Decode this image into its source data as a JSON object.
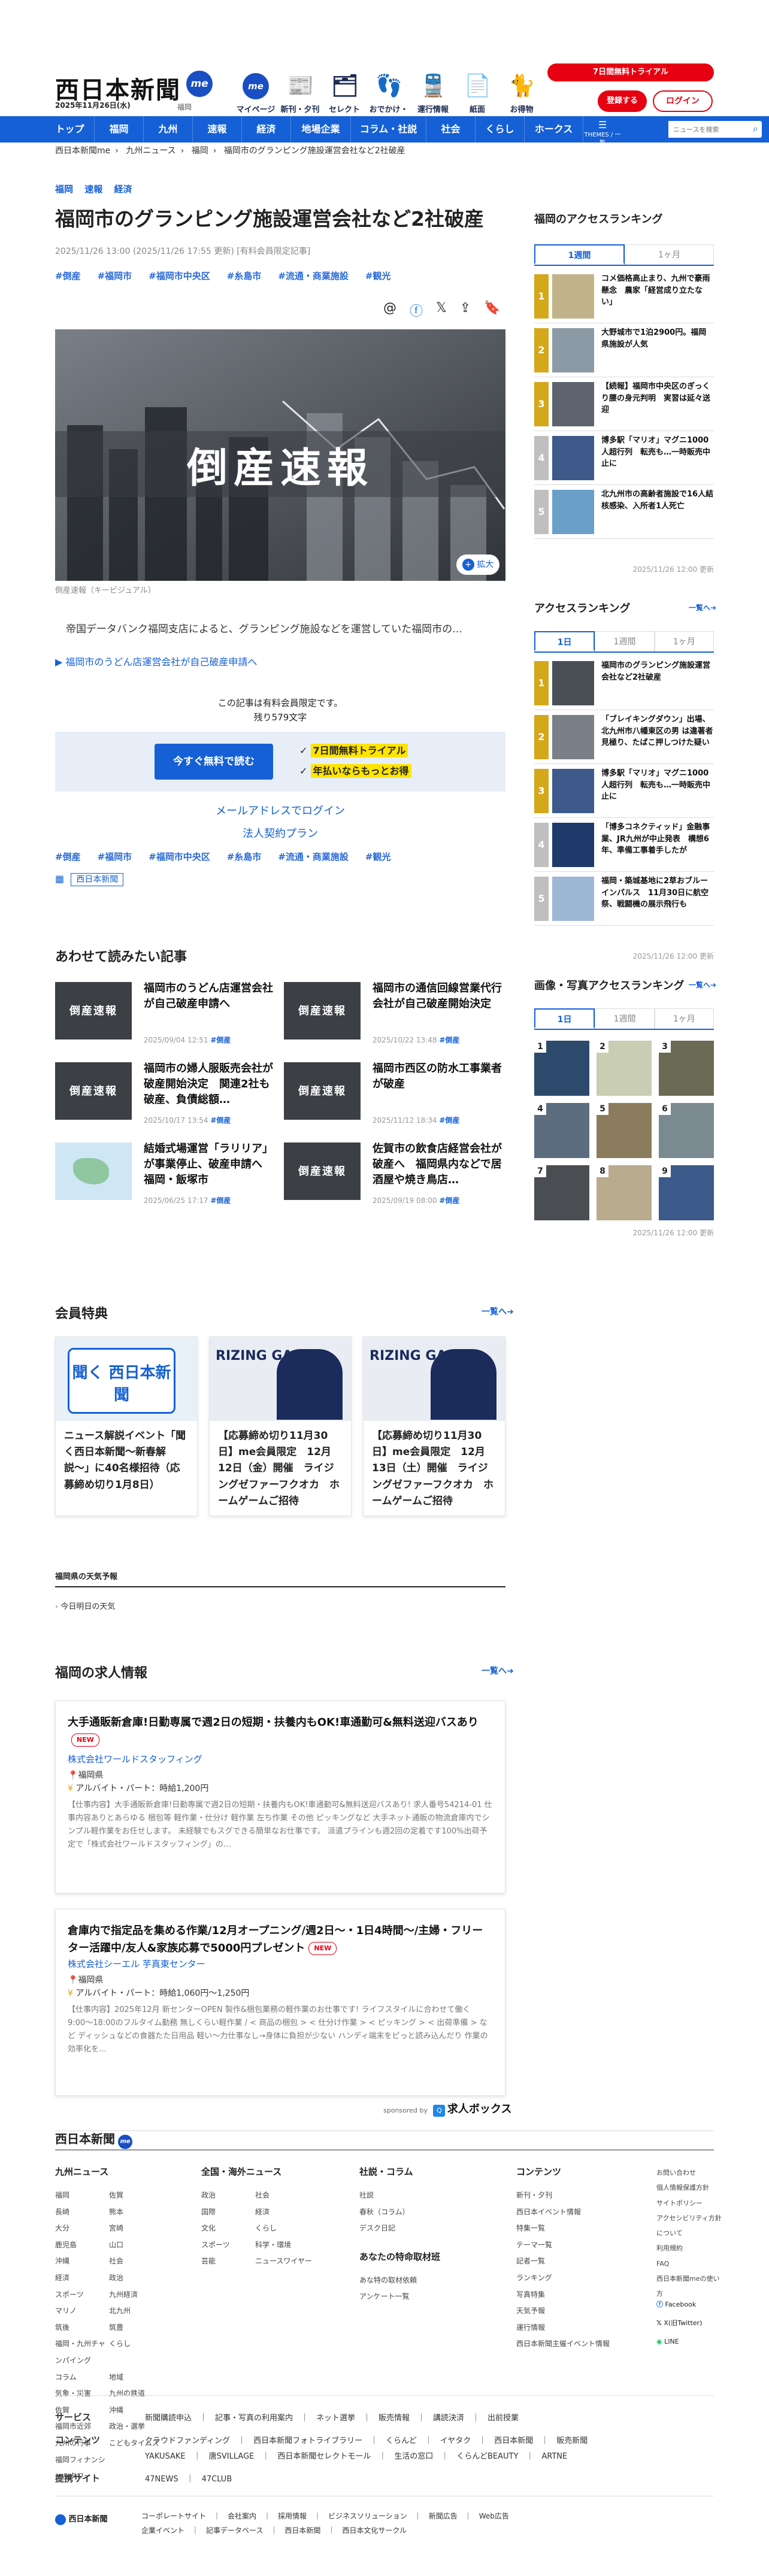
{
  "header": {
    "logo": "西日本新聞",
    "me_badge": "me",
    "date": "2025年11月26日(水)",
    "region": "福岡",
    "icons": [
      {
        "label": "マイページ",
        "icon": "me"
      },
      {
        "label": "新刊・夕刊",
        "icon": "newspaper-icon"
      },
      {
        "label": "セレクト",
        "icon": "select-icon"
      },
      {
        "label": "おでかけ・特典",
        "icon": "footprint-icon"
      },
      {
        "label": "運行情報",
        "icon": "train-icon"
      },
      {
        "label": "紙面",
        "icon": "paper-icon"
      },
      {
        "label": "お得物",
        "icon": "cat-icon"
      }
    ],
    "trial": "7日間無料トライアル",
    "register": "登録する",
    "login": "ログイン"
  },
  "nav": {
    "items": [
      "トップ",
      "福岡",
      "九州",
      "速報",
      "経済",
      "地場企業",
      "コラム・社説",
      "社会",
      "くらし",
      "ホークス"
    ],
    "theme": "THEMES / 一覧",
    "search_placeholder": "ニュースを検索"
  },
  "breadcrumb": [
    "西日本新聞me",
    "九州ニュース",
    "福岡",
    "福岡市のグランピング施設運営会社など2社破産"
  ],
  "article": {
    "tags_top": [
      "福岡",
      "速報",
      "経済"
    ],
    "title": "福岡市のグランピング施設運営会社など2社破産",
    "date": "2025/11/26 13:00 (2025/11/26 17:55 更新)",
    "paid_note": "[有料会員限定記事]",
    "hashtags": [
      "#倒産",
      "#福岡市",
      "#福岡市中央区",
      "#糸島市",
      "#流通・商業施設",
      "#観光"
    ],
    "hero_text": "倒産速報",
    "zoom": "拡大",
    "caption": "倒産速報（キービジュアル）",
    "lead": "帝国データバンク福岡支店によると、グランピング施設などを運営していた福岡市の…",
    "related_link": "福岡市のうどん店運営会社が自己破産申請へ",
    "paywall_1": "この記事は有料会員限定です。",
    "paywall_2": "残り579文字",
    "cta": "今すぐ無料で読む",
    "benefit_1": "7日間無料トライアル",
    "benefit_2": "年払いならもっとお得",
    "email_login": "メールアドレスでログイン",
    "corp_plan": "法人契約プラン",
    "hashtags_bottom": [
      "#倒産",
      "#福岡市",
      "#福岡市中央区",
      "#糸島市",
      "#流通・商業施設",
      "#観光"
    ],
    "area_label": "西日本新聞"
  },
  "related": {
    "title": "あわせて読みたい記事",
    "items": [
      {
        "title": "福岡市のうどん店運営会社が自己破産申請へ",
        "date": "2025/09/04 12:51",
        "tag": "#倒産",
        "thumb": "倒産速報"
      },
      {
        "title": "福岡市の通信回線営業代行会社が自己破産開始決定",
        "date": "2025/10/22 13:48",
        "tag": "#倒産",
        "thumb": "倒産速報"
      },
      {
        "title": "福岡市の婦人服販売会社が破産開始決定　関連2社も破産、負債総額…",
        "date": "2025/10/17 13:54",
        "tag": "#倒産",
        "thumb": "倒産速報"
      },
      {
        "title": "福岡市西区の防水工事業者が破産",
        "date": "2025/11/12 18:34",
        "tag": "#倒産",
        "thumb": "倒産速報"
      },
      {
        "title": "結婚式場運営「ラリリア」が事業停止、破産申請へ　福岡・飯塚市",
        "date": "2025/06/25 17:17",
        "tag": "#倒産",
        "thumb": "map"
      },
      {
        "title": "佐賀市の飲食店経営会社が破産へ　福岡県内などで居酒屋や焼き鳥店…",
        "date": "2025/09/19 08:00",
        "tag": "#倒産",
        "thumb": "倒産速報"
      }
    ]
  },
  "member": {
    "title": "会員特典",
    "more": "一覧へ",
    "items": [
      {
        "title": "ニュース解説イベント「聞く西日本新聞〜新春解説〜」に40名様招待（応募締め切り1月8日）",
        "img": "聞く 西日本新聞"
      },
      {
        "title": "【応募締め切り11月30日】me会員限定　12月12日（金）開催　ライジングゼファーフクオカ　ホームゲームご招待",
        "img": "RIZING GAME"
      },
      {
        "title": "【応募締め切り11月30日】me会員限定　12月13日（土）開催　ライジングゼファーフクオカ　ホームゲームご招待",
        "img": "RIZING GAME"
      }
    ]
  },
  "weather": {
    "title": "福岡県の天気予報",
    "link": "今日明日の天気"
  },
  "jobs": {
    "title": "福岡の求人情報",
    "more": "一覧へ",
    "new_label": "NEW",
    "items": [
      {
        "title": "大手通販新倉庫!日勤専属で週2日の短期・扶養内もOK!車通勤可&無料送迎バスあり",
        "company": "株式会社ワールドスタッフィング",
        "location": "福岡県",
        "pay": "アルバイト・パート：時給1,200円",
        "desc": "【仕事内容】大手通販新倉庫!日勤専属で週2日の短期・扶養内もOK!車通勤可&無料送迎バスあり! 求人番号54214-01 仕事内容ありとあらゆる 梱包等 軽作業・仕分け 軽作業 左ち作業 その他 ピッキングなど 大手ネット通販の物流倉庫内でシンプル軽作業をお任せします。 未経験でもスグできる簡単なお仕事です。 派遣プラインも週2回の定着です100%出荷予定で「株式会社ワールドスタッフィング」の…"
      },
      {
        "title": "倉庫内で指定品を集める作業/12月オープニング/週2日〜・1日4時間〜/主婦・フリーター活躍中/友人&家族応募で5000円プレゼント",
        "company": "株式会社シーエル 芋真東センター",
        "location": "福岡県",
        "pay": "アルバイト・パート：時給1,060円〜1,250円",
        "desc": "【仕事内容】2025年12月 新センターOPEN 製作&梱包業務の軽作業のお仕事です! ライフスタイルに合わせて働く9:00〜18:00のフルタイム勤務 無しくらい軽作業 / < 商品の梱包 > < 仕分け作業 > < ピッキング > < 出荷準備 > など ディッシュなどの食器たた日用品 軽い〜力仕事なし→身体に負担が少ない ハンディ端末をピっと読み込んだり 作業の効率化を…"
      }
    ],
    "sponsor": "sponsored by",
    "sponsor_name": "求人ボックス"
  },
  "sidebar": {
    "rank_title": "福岡のアクセスランキング",
    "rank_tabs": [
      "1週間",
      "1ヶ月"
    ],
    "rank_items": [
      "コメ価格高止まり、九州で豪雨懸念　農家「経営成り立たない」",
      "大野城市で1泊2900円。福岡県施設が人気",
      "【続報】福岡市中央区のぎっくり腰の身元判明　実習は延々送迎",
      "博多駅「マリオ」マグニ1000人超行列　転売も…一時販売中止に",
      "北九州市の高齢者施設で16人結核感染、入所者1人死亡"
    ],
    "rank_update": "2025/11/26 12:00 更新",
    "access_title": "アクセスランキング",
    "access_more": "一覧へ",
    "access_tabs": [
      "1日",
      "1週間",
      "1ヶ月"
    ],
    "access_items": [
      "福岡市のグランピング施設運営会社など2社破産",
      "「ブレイキングダウン」出場、北九州市八幡東区の男 は違著者見極り、たばこ押しつけた疑い",
      "博多駅「マリオ」マグニ1000人超行列　転売も…一時販売中止に",
      "「博多コネクティッド」金融事業、JR九州が中止発表　構想6年、準備工事着手したが",
      "福岡・築城基地に2草おブルーインパルス　11月30日に航空祭、戦闘機の展示飛行も"
    ],
    "access_update": "2025/11/26 12:00 更新",
    "photo_title": "画像・写真アクセスランキング",
    "photo_more": "一覧へ",
    "photo_tabs": [
      "1日",
      "1週間",
      "1ヶ月"
    ],
    "photo_update": "2025/11/26 12:00 更新"
  },
  "footer": {
    "logo": "西日本新聞",
    "cols": [
      {
        "title": "九州ニュース",
        "items": [
          "福岡",
          "佐賀",
          "長崎",
          "熊本",
          "大分",
          "宮崎",
          "鹿児島",
          "山口",
          "沖縄",
          "社会",
          "経済",
          "政治",
          "スポーツ",
          "九州経済",
          "マリノ",
          "北九州",
          "筑後",
          "筑豊",
          "福岡・九州チャンパイング",
          "くらし",
          "コラム",
          "地域",
          "気象・災害",
          "九州の鉄道",
          "佐賀",
          "沖縄",
          "福岡市近郊",
          "政治・選挙",
          "九州の行事",
          "こどもタイムズ",
          "福岡フィナンシャルタワー"
        ]
      },
      {
        "title": "全国・海外ニュース",
        "items": [
          "政治",
          "社会",
          "国際",
          "経済",
          "文化",
          "くらし",
          "スポーツ",
          "科学・環境",
          "芸能",
          "ニュースワイヤー"
        ]
      },
      {
        "title": "社説・コラム",
        "items": [
          "社説",
          "春秋（コラム）",
          "デスク日記"
        ]
      },
      {
        "title": "コンテンツ",
        "items": [
          "新刊・夕刊",
          "西日本イベント情報",
          "特集一覧",
          "テーマ一覧",
          "記者一覧",
          "ランキング",
          "写真特集",
          "天気予報",
          "運行情報",
          "西日本新聞主催イベント情報"
        ]
      }
    ],
    "special_title": "あなたの特命取材班",
    "special_items": [
      "あな特の取材依頼",
      "アンケート一覧"
    ],
    "links": [
      "お問い合わせ",
      "個人情報保護方針",
      "サイトポリシー",
      "アクセシビリティ方針について",
      "利用規約",
      "FAQ",
      "西日本新聞meの使い方"
    ],
    "social": [
      "Facebook",
      "X(旧Twitter)",
      "LINE"
    ],
    "service_label": "サービス",
    "service": "新聞購読申込　｜　記事・写真の利用案内　｜　ネット選挙　｜　販売情報　｜　講読決済　｜　出前授業",
    "content_label": "コンテンツ",
    "content": "クラウドファンディング　｜　西日本新聞フォトライブラリー　｜　くらんど　｜　イヤタク　｜　西日本新聞　｜　販売新聞\nYAKUSAKE　｜　唐SVILLAGE　｜　西日本新聞セレクトモール　｜　生活の窓口　｜　くらんどBEAUTY　｜　ARTNE",
    "partner_label": "提携サイト",
    "partner": "47NEWS　｜　47CLUB",
    "company_logo": "西日本新聞",
    "company_links": "コーポレートサイト　｜　会社案内　｜　採用情報　｜　ビジネスソリューション　｜　新聞広告　｜　Web広告\n企業イベント　｜　記事データベース　｜　西日本新聞　｜　西日本文化サークル"
  },
  "colors": {
    "brand": "#1560d6",
    "red": "#e60012",
    "yellow": "#ffe400"
  }
}
